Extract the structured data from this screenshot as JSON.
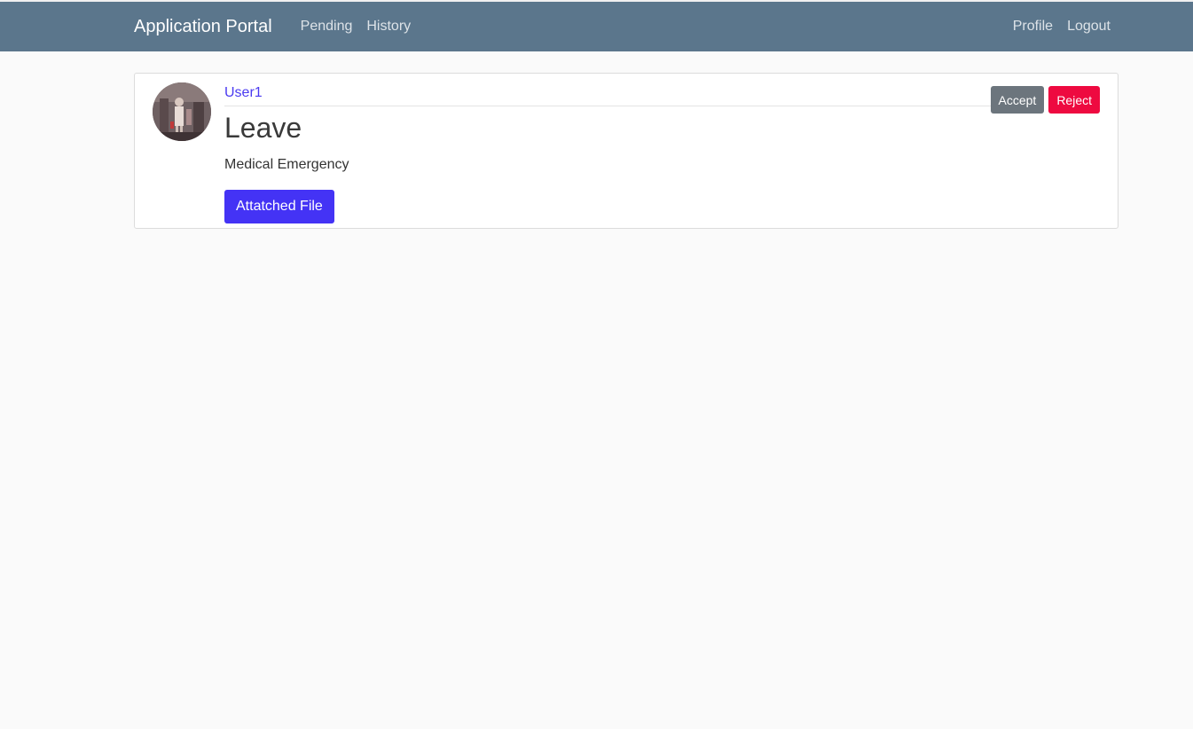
{
  "navbar": {
    "brand": "Application Portal",
    "links": [
      "Pending",
      "History"
    ],
    "right_links": [
      "Profile",
      "Logout"
    ],
    "bg_color": "#5b768c"
  },
  "application": {
    "username": "User1",
    "title": "Leave",
    "description": "Medical Emergency",
    "attach_label": "Attatched File",
    "accept_label": "Accept",
    "reject_label": "Reject"
  },
  "colors": {
    "accent": "#4433f5",
    "reject": "#ee0a40",
    "accept": "#6c757d"
  }
}
